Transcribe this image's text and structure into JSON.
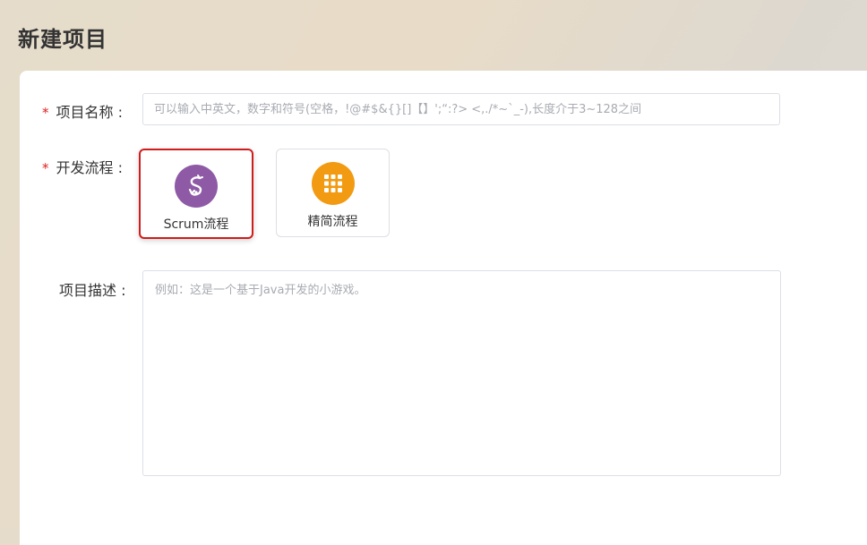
{
  "page": {
    "title": "新建项目"
  },
  "form": {
    "name": {
      "required_mark": "*",
      "label": "项目名称 :",
      "placeholder": "可以输入中英文，数字和符号(空格，!@#$&{}[]【】';“:?> <,./*~`_-),长度介于3~128之间",
      "value": ""
    },
    "flow": {
      "required_mark": "*",
      "label": "开发流程 :",
      "options": [
        {
          "label": "Scrum流程",
          "icon": "scrum-icon",
          "color": "#8e5aa6",
          "selected": true
        },
        {
          "label": "精简流程",
          "icon": "grid-icon",
          "color": "#f29a12",
          "selected": false
        }
      ]
    },
    "description": {
      "label": "项目描述 :",
      "placeholder": "例如：这是一个基于Java开发的小游戏。",
      "value": ""
    }
  },
  "colors": {
    "required": "#e02020",
    "selected_border": "#d01c1c"
  }
}
